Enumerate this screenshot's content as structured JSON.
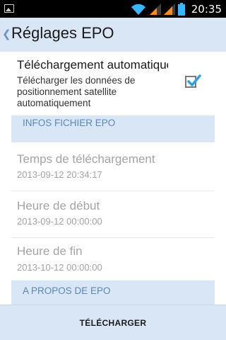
{
  "status_bar": {
    "time": "20:35",
    "icons": [
      "gallery-icon",
      "wifi-icon",
      "signal-icon",
      "signal-icon",
      "battery-icon"
    ]
  },
  "action_bar": {
    "title": "Réglages EPO"
  },
  "auto_download": {
    "title": "Téléchargement automatique",
    "summary": "Télécharger les données de positionnement satellite automatiquement",
    "checked": true
  },
  "sections": {
    "file_info": "INFOS FICHIER EPO",
    "about": "A PROPOS DE EPO"
  },
  "items": [
    {
      "title": "Temps de téléchargement",
      "value": "2013-09-12 20:34:17"
    },
    {
      "title": "Heure de début",
      "value": "2013-09-12 00:00:00"
    },
    {
      "title": "Heure de fin",
      "value": "2013-10-12 00:00:00"
    }
  ],
  "bottom": {
    "download_label": "TÉLÉCHARGER"
  },
  "colors": {
    "accent": "#5b86bf",
    "bar_background": "#d9e6f5",
    "disabled_text": "#a4a4a4"
  }
}
